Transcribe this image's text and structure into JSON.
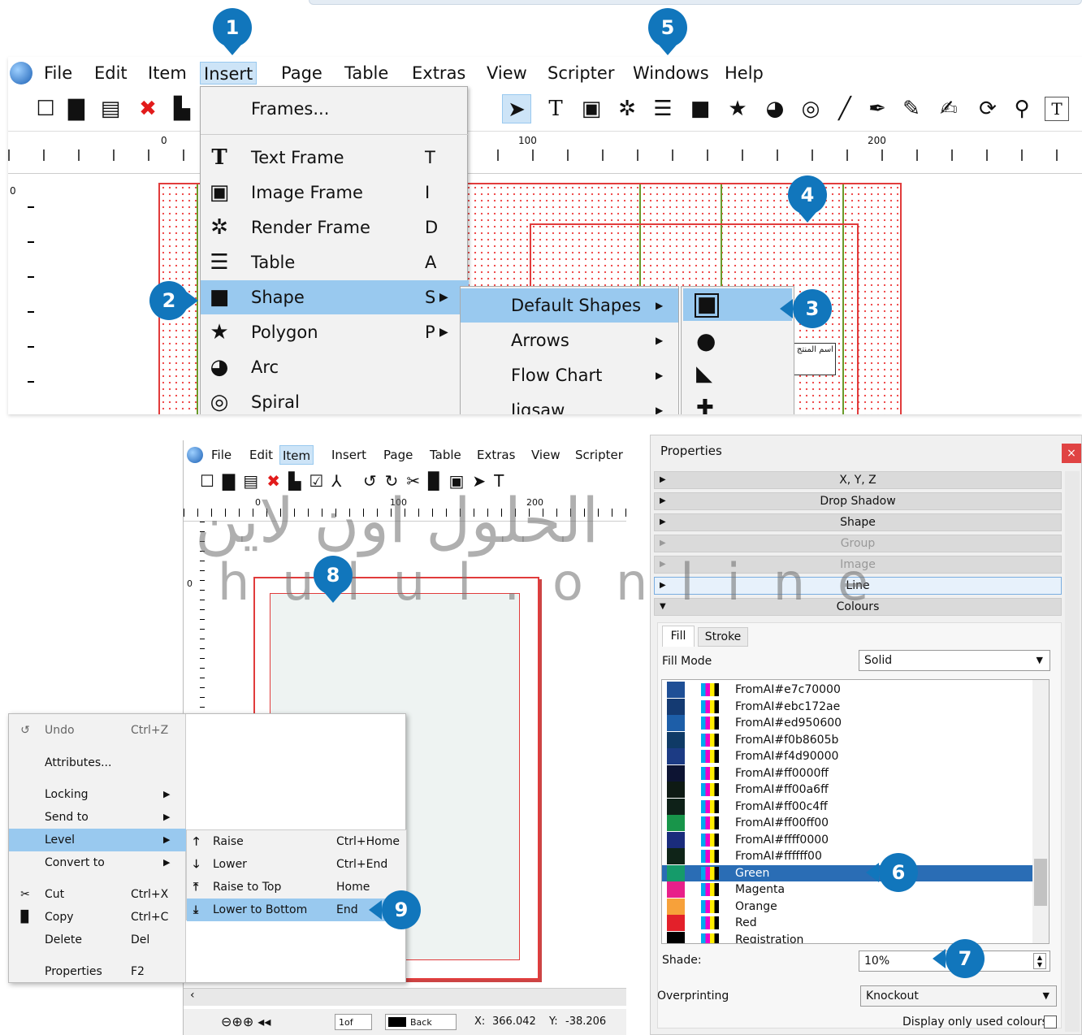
{
  "top_window": {
    "menu": [
      "File",
      "Edit",
      "Item",
      "Insert",
      "Page",
      "Table",
      "Extras",
      "View",
      "Scripter",
      "Windows",
      "Help"
    ],
    "ruler_labels": [
      "0",
      "100",
      "200"
    ],
    "insert_menu": [
      {
        "label": "Frames...",
        "shortcut": ""
      },
      {
        "label": "Text Frame",
        "shortcut": "T"
      },
      {
        "label": "Image Frame",
        "shortcut": "I"
      },
      {
        "label": "Render Frame",
        "shortcut": "D"
      },
      {
        "label": "Table",
        "shortcut": "A"
      },
      {
        "label": "Shape",
        "shortcut": "S"
      },
      {
        "label": "Polygon",
        "shortcut": "P"
      },
      {
        "label": "Arc",
        "shortcut": ""
      },
      {
        "label": "Spiral",
        "shortcut": ""
      }
    ],
    "shape_submenu": [
      "Default Shapes",
      "Arrows",
      "Flow Chart",
      "Jigsaw"
    ],
    "page_text": "اسم المنتج",
    "vruler_label": "0"
  },
  "badges": [
    "1",
    "2",
    "3",
    "4",
    "5",
    "6",
    "7",
    "8",
    "9"
  ],
  "bottom_window": {
    "menu": [
      "File",
      "Edit",
      "Item",
      "Insert",
      "Page",
      "Table",
      "Extras",
      "View",
      "Scripter"
    ],
    "ruler_labels": [
      "0",
      "100",
      "200"
    ],
    "vruler_label": "0",
    "status": {
      "page": "1of",
      "layer": "Back",
      "x_label": "X:",
      "x_value": "366.042",
      "y_label": "Y:",
      "y_value": "-38.206"
    }
  },
  "context_menu": {
    "items": [
      {
        "label": "Undo",
        "shortcut": "Ctrl+Z"
      },
      {
        "label": "Attributes...",
        "shortcut": ""
      },
      {
        "label": "Locking",
        "shortcut": ""
      },
      {
        "label": "Send to",
        "shortcut": ""
      },
      {
        "label": "Level",
        "shortcut": ""
      },
      {
        "label": "Convert to",
        "shortcut": ""
      },
      {
        "label": "Cut",
        "shortcut": "Ctrl+X"
      },
      {
        "label": "Copy",
        "shortcut": "Ctrl+C"
      },
      {
        "label": "Delete",
        "shortcut": "Del"
      },
      {
        "label": "Properties",
        "shortcut": "F2"
      }
    ],
    "level_submenu": [
      {
        "label": "Raise",
        "shortcut": "Ctrl+Home"
      },
      {
        "label": "Lower",
        "shortcut": "Ctrl+End"
      },
      {
        "label": "Raise to Top",
        "shortcut": "Home"
      },
      {
        "label": "Lower to Bottom",
        "shortcut": "End"
      }
    ]
  },
  "properties": {
    "title": "Properties",
    "sections": [
      "X, Y, Z",
      "Drop Shadow",
      "Shape",
      "Group",
      "Image",
      "Line",
      "Colours"
    ],
    "tabs": [
      "Fill",
      "Stroke"
    ],
    "fill_mode_label": "Fill Mode",
    "fill_mode_value": "Solid",
    "colours": [
      {
        "name": "FromAI#e7c70000",
        "hex": "#1f4f96"
      },
      {
        "name": "FromAI#ebc172ae",
        "hex": "#143a72"
      },
      {
        "name": "FromAI#ed950600",
        "hex": "#1d5ea8"
      },
      {
        "name": "FromAI#f0b8605b",
        "hex": "#0f3a66"
      },
      {
        "name": "FromAI#f4d90000",
        "hex": "#1c3b84"
      },
      {
        "name": "FromAI#ff0000ff",
        "hex": "#0d1433"
      },
      {
        "name": "FromAI#ff00a6ff",
        "hex": "#0e1a14"
      },
      {
        "name": "FromAI#ff00c4ff",
        "hex": "#0e2118"
      },
      {
        "name": "FromAI#ff00ff00",
        "hex": "#18954a"
      },
      {
        "name": "FromAI#ffff0000",
        "hex": "#1a2c7c"
      },
      {
        "name": "FromAI#ffffff00",
        "hex": "#0f2418"
      },
      {
        "name": "Green",
        "hex": "#159b6a"
      },
      {
        "name": "Magenta",
        "hex": "#e8208a"
      },
      {
        "name": "Orange",
        "hex": "#f7a13a"
      },
      {
        "name": "Red",
        "hex": "#e3202a"
      },
      {
        "name": "Registration",
        "hex": "#000000"
      }
    ],
    "selected_colour": "Green",
    "shade_label": "Shade:",
    "shade_value": "10%",
    "overprinting_label": "Overprinting",
    "overprinting_value": "Knockout",
    "display_used_label": "Display only used colours"
  },
  "watermark": {
    "arabic": "الحلول اون لاين",
    "latin": "hulul.online"
  },
  "colors": {
    "accent": "#1176bc",
    "highlight": "#99c9ef",
    "page_border": "#e13c3c"
  }
}
